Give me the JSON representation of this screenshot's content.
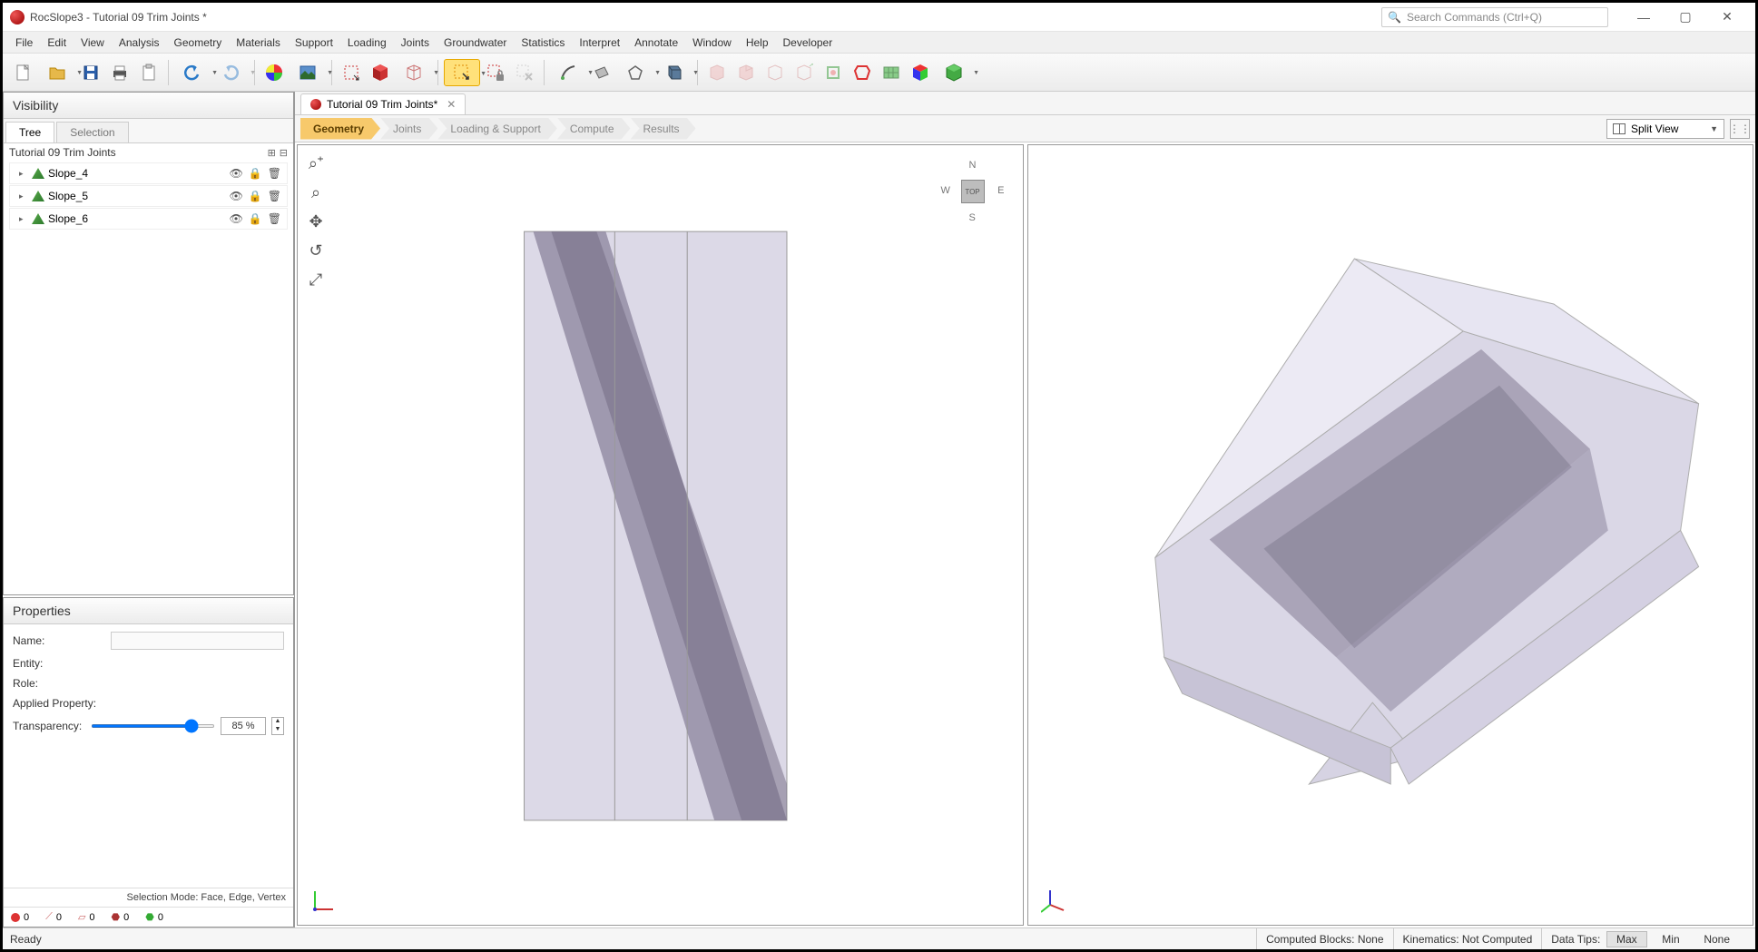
{
  "titlebar": {
    "app_title": "RocSlope3 - Tutorial 09 Trim Joints *",
    "search_placeholder": "Search Commands (Ctrl+Q)"
  },
  "menubar": [
    "File",
    "Edit",
    "View",
    "Analysis",
    "Geometry",
    "Materials",
    "Support",
    "Loading",
    "Joints",
    "Groundwater",
    "Statistics",
    "Interpret",
    "Annotate",
    "Window",
    "Help",
    "Developer"
  ],
  "doctab": {
    "label": "Tutorial 09 Trim Joints*"
  },
  "stages": [
    "Geometry",
    "Joints",
    "Loading & Support",
    "Compute",
    "Results"
  ],
  "active_stage": 0,
  "view_selector": "Split View",
  "visibility": {
    "title": "Visibility",
    "tabs": [
      "Tree",
      "Selection"
    ],
    "root": "Tutorial 09 Trim Joints",
    "items": [
      {
        "label": "Slope_4"
      },
      {
        "label": "Slope_5"
      },
      {
        "label": "Slope_6"
      }
    ]
  },
  "properties": {
    "title": "Properties",
    "name_label": "Name:",
    "entity_label": "Entity:",
    "role_label": "Role:",
    "applied_label": "Applied Property:",
    "transparency_label": "Transparency:",
    "transparency_value": "85 %"
  },
  "selection_mode": "Selection Mode: Face, Edge, Vertex",
  "counts": {
    "pt": "0",
    "edge": "0",
    "face": "0",
    "vol": "0",
    "grp": "0"
  },
  "compass": {
    "n": "N",
    "s": "S",
    "e": "E",
    "w": "W",
    "top": "TOP"
  },
  "status": {
    "ready": "Ready",
    "computed_blocks_label": "Computed Blocks:",
    "computed_blocks_value": "None",
    "kinematics_label": "Kinematics:",
    "kinematics_value": "Not Computed",
    "data_tips_label": "Data Tips:",
    "max": "Max",
    "min": "Min",
    "none": "None"
  }
}
